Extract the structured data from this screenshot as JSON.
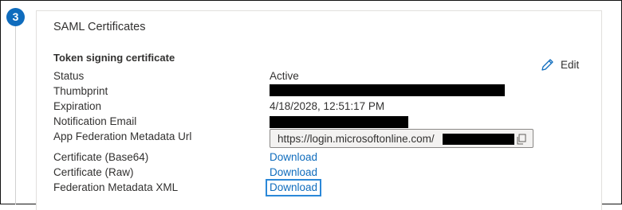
{
  "step": {
    "number": "3",
    "badge_color": "#0f6cbd"
  },
  "card": {
    "title": "SAML Certificates",
    "edit_label": "Edit",
    "edit_icon": "pencil-icon"
  },
  "token_signing": {
    "heading": "Token signing certificate",
    "rows": {
      "status": {
        "label": "Status",
        "value": "Active"
      },
      "thumbprint": {
        "label": "Thumbprint",
        "value": ""
      },
      "expiration": {
        "label": "Expiration",
        "value": "4/18/2028, 12:51:17 PM"
      },
      "notification_email": {
        "label": "Notification Email",
        "value": ""
      },
      "app_federation_url": {
        "label": "App Federation Metadata Url",
        "value": "https://login.microsoftonline.com/",
        "copy_icon": "copy-icon"
      },
      "cert_base64": {
        "label": "Certificate (Base64)",
        "link": "Download"
      },
      "cert_raw": {
        "label": "Certificate (Raw)",
        "link": "Download"
      },
      "federation_xml": {
        "label": "Federation Metadata XML",
        "link": "Download"
      }
    }
  },
  "colors": {
    "link": "#0f6cbd",
    "focus_ring": "#2b88d8",
    "redaction": "#000000"
  }
}
